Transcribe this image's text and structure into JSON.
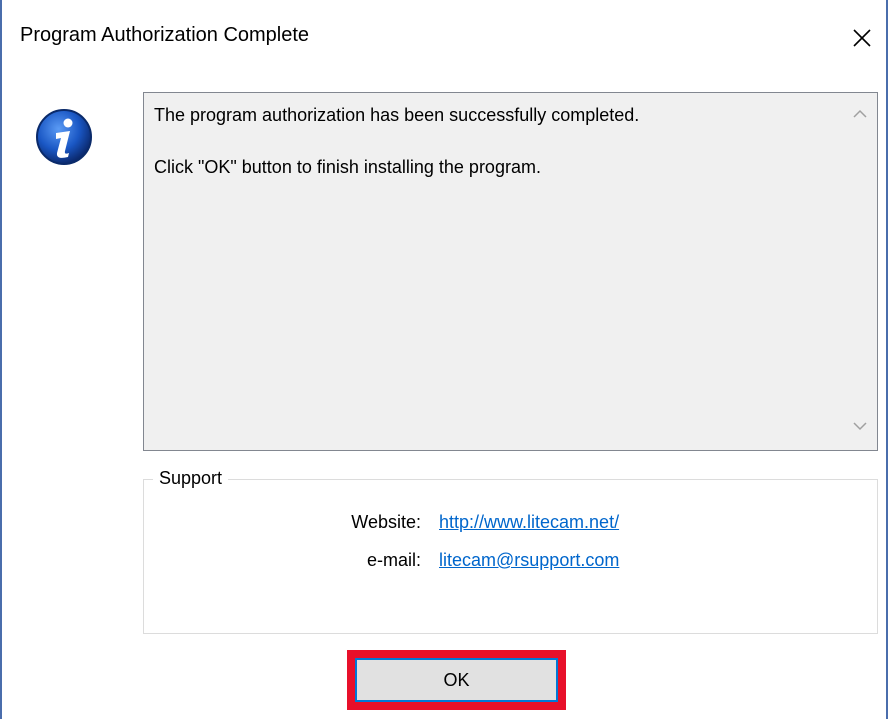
{
  "window": {
    "title": "Program Authorization Complete",
    "close_icon": "close-icon"
  },
  "icon": {
    "name": "info-icon",
    "color": "#1a57c4"
  },
  "message": {
    "line1": "The program authorization has been successfully completed.",
    "line2": "Click \"OK\" button to finish installing the program."
  },
  "support": {
    "group_label": "Support",
    "website_label": "Website:",
    "website_value": "http://www.litecam.net/",
    "email_label": "e-mail:",
    "email_value": "litecam@rsupport.com"
  },
  "buttons": {
    "ok_label": "OK"
  },
  "colors": {
    "link": "#0066cc",
    "highlight": "#e8102a",
    "border_accent": "#4a6dac"
  }
}
